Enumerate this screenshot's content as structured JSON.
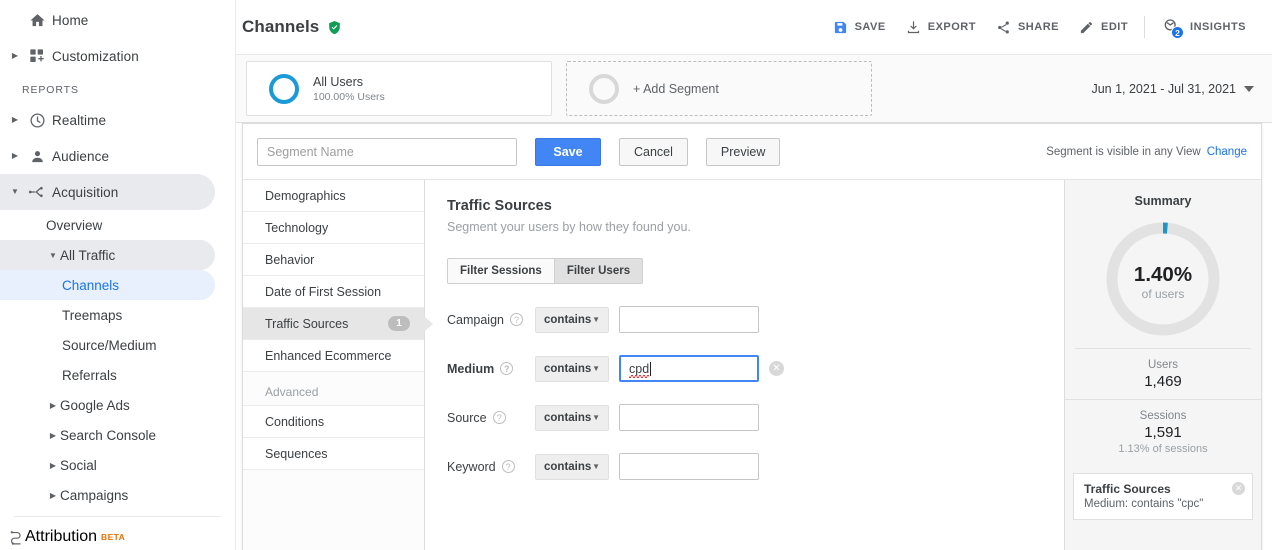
{
  "sidebar": {
    "top_items": [
      {
        "label": "Home",
        "icon": "home-icon",
        "caret": false
      },
      {
        "label": "Customization",
        "icon": "customization-icon",
        "caret": true
      }
    ],
    "section_label": "REPORTS",
    "report_items": [
      {
        "label": "Realtime",
        "icon": "clock-icon",
        "caret": true
      },
      {
        "label": "Audience",
        "icon": "person-icon",
        "caret": true
      },
      {
        "label": "Acquisition",
        "icon": "acquisition-icon",
        "caret": true,
        "expanded": true,
        "selected": true
      }
    ],
    "acquisition_children": [
      {
        "label": "Overview",
        "level": 2,
        "caret": false,
        "state": "none"
      },
      {
        "label": "All Traffic",
        "level": 2,
        "caret": true,
        "state": "grey"
      },
      {
        "label": "Channels",
        "level": 3,
        "caret": false,
        "state": "blue"
      },
      {
        "label": "Treemaps",
        "level": 3,
        "caret": false,
        "state": "none"
      },
      {
        "label": "Source/Medium",
        "level": 3,
        "caret": false,
        "state": "none"
      },
      {
        "label": "Referrals",
        "level": 3,
        "caret": false,
        "state": "none"
      },
      {
        "label": "Google Ads",
        "level": 2,
        "caret": true,
        "state": "none"
      },
      {
        "label": "Search Console",
        "level": 2,
        "caret": true,
        "state": "none"
      },
      {
        "label": "Social",
        "level": 2,
        "caret": true,
        "state": "none"
      },
      {
        "label": "Campaigns",
        "level": 2,
        "caret": true,
        "state": "none"
      }
    ],
    "attribution": {
      "label": "Attribution",
      "badge": "BETA",
      "icon": "attribution-icon"
    }
  },
  "header": {
    "title": "Channels",
    "verified_icon": "verified-shield-icon",
    "actions": [
      {
        "label": "SAVE",
        "icon": "save-icon"
      },
      {
        "label": "EXPORT",
        "icon": "export-icon"
      },
      {
        "label": "SHARE",
        "icon": "share-icon"
      },
      {
        "label": "EDIT",
        "icon": "edit-pencil-icon"
      }
    ],
    "insights": {
      "label": "INSIGHTS",
      "icon": "insights-icon",
      "badge": "2"
    }
  },
  "segment_bar": {
    "all_users": {
      "title": "All Users",
      "subtitle": "100.00% Users"
    },
    "add_segment": {
      "label": "+ Add Segment"
    },
    "date_range": "Jun 1, 2021 - Jul 31, 2021"
  },
  "builder": {
    "name_placeholder": "Segment Name",
    "name_value": "",
    "save_label": "Save",
    "cancel_label": "Cancel",
    "preview_label": "Preview",
    "visibility_text": "Segment is visible in any View",
    "change_link": "Change",
    "categories": [
      {
        "label": "Demographics",
        "count": "",
        "selected": false
      },
      {
        "label": "Technology",
        "count": "",
        "selected": false
      },
      {
        "label": "Behavior",
        "count": "",
        "selected": false
      },
      {
        "label": "Date of First Session",
        "count": "",
        "selected": false
      },
      {
        "label": "Traffic Sources",
        "count": "1",
        "selected": true
      },
      {
        "label": "Enhanced Ecommerce",
        "count": "",
        "selected": false
      }
    ],
    "advanced_label": "Advanced",
    "advanced_categories": [
      {
        "label": "Conditions",
        "count": "",
        "selected": false
      },
      {
        "label": "Sequences",
        "count": "",
        "selected": false
      }
    ],
    "pane": {
      "title": "Traffic Sources",
      "subtitle": "Segment your users by how they found you.",
      "toggles": [
        {
          "label": "Filter Sessions",
          "active": false
        },
        {
          "label": "Filter Users",
          "active": true
        }
      ],
      "filters": [
        {
          "label": "Campaign",
          "operator": "contains",
          "value": "",
          "bold": false,
          "focused": false,
          "clearable": false,
          "misspelled": false
        },
        {
          "label": "Medium",
          "operator": "contains",
          "value": "cpd",
          "bold": true,
          "focused": true,
          "clearable": true,
          "misspelled": true
        },
        {
          "label": "Source",
          "operator": "contains",
          "value": "",
          "bold": false,
          "focused": false,
          "clearable": false,
          "misspelled": false
        },
        {
          "label": "Keyword",
          "operator": "contains",
          "value": "",
          "bold": false,
          "focused": false,
          "clearable": false,
          "misspelled": false
        }
      ]
    },
    "summary": {
      "title": "Summary",
      "donut_percent": "1.40%",
      "donut_value": 1.4,
      "donut_caption": "of users",
      "metrics": [
        {
          "label": "Users",
          "value": "1,469",
          "sub": ""
        },
        {
          "label": "Sessions",
          "value": "1,591",
          "sub": "1.13% of sessions"
        }
      ],
      "condition_card": {
        "title": "Traffic Sources",
        "detail": "Medium: contains \"cpc\""
      }
    }
  },
  "colors": {
    "accent_blue": "#1a73e8",
    "primary_button": "#4285f4",
    "segment_ring": "#1a9ad6",
    "verified_green": "#0f9d58",
    "beta_orange": "#e8710a"
  }
}
